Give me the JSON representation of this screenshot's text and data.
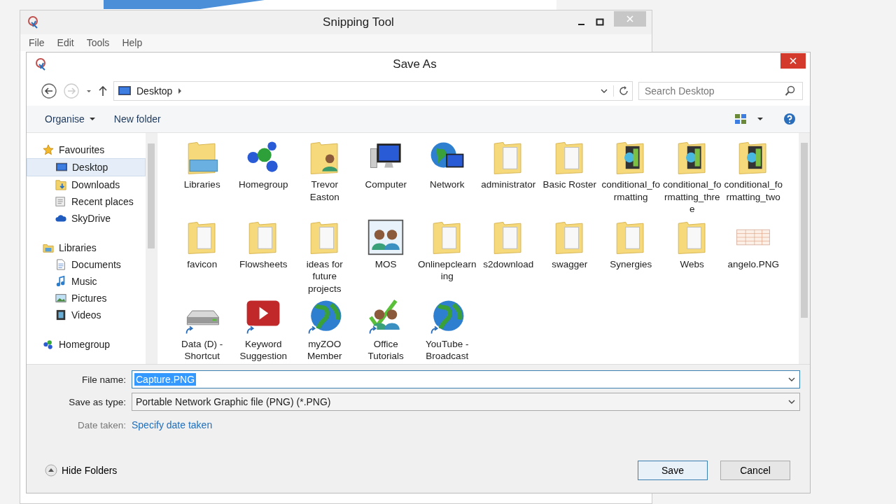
{
  "snipping_tool": {
    "title": "Snipping Tool",
    "menu": [
      "File",
      "Edit",
      "Tools",
      "Help"
    ]
  },
  "dialog": {
    "title": "Save As",
    "address": {
      "location": "Desktop"
    },
    "search": {
      "placeholder": "Search Desktop"
    },
    "toolbar": {
      "organise": "Organise",
      "new_folder": "New folder"
    },
    "sidebar": [
      {
        "label": "Favourites",
        "kind": "star",
        "selected": false,
        "children": [
          {
            "label": "Desktop",
            "kind": "desktop",
            "selected": true
          },
          {
            "label": "Downloads",
            "kind": "downloads",
            "selected": false
          },
          {
            "label": "Recent places",
            "kind": "recent",
            "selected": false
          },
          {
            "label": "SkyDrive",
            "kind": "cloud",
            "selected": false
          }
        ]
      },
      {
        "label": "Libraries",
        "kind": "library",
        "selected": false,
        "children": [
          {
            "label": "Documents",
            "kind": "documents",
            "selected": false
          },
          {
            "label": "Music",
            "kind": "music",
            "selected": false
          },
          {
            "label": "Pictures",
            "kind": "pictures",
            "selected": false
          },
          {
            "label": "Videos",
            "kind": "videos",
            "selected": false
          }
        ]
      },
      {
        "label": "Homegroup",
        "kind": "homegroup",
        "selected": false
      }
    ],
    "items": [
      {
        "label": "Libraries",
        "kind": "library",
        "shortcut": false
      },
      {
        "label": "Homegroup",
        "kind": "homegroup",
        "shortcut": false
      },
      {
        "label": "Trevor Easton",
        "kind": "user",
        "shortcut": false
      },
      {
        "label": "Computer",
        "kind": "computer",
        "shortcut": false
      },
      {
        "label": "Network",
        "kind": "network",
        "shortcut": false
      },
      {
        "label": "administrator",
        "kind": "folder",
        "shortcut": false
      },
      {
        "label": "Basic Roster",
        "kind": "folder",
        "shortcut": false
      },
      {
        "label": "conditional_formatting",
        "kind": "media_folder",
        "shortcut": false
      },
      {
        "label": "conditional_formatting_three",
        "kind": "media_folder",
        "shortcut": false
      },
      {
        "label": "conditional_formatting_two",
        "kind": "media_folder",
        "shortcut": false
      },
      {
        "label": "favicon",
        "kind": "folder",
        "shortcut": false
      },
      {
        "label": "Flowsheets",
        "kind": "folder",
        "shortcut": false
      },
      {
        "label": "ideas for future projects",
        "kind": "folder",
        "shortcut": false
      },
      {
        "label": "MOS",
        "kind": "people",
        "shortcut": false
      },
      {
        "label": "Onlinepclearning",
        "kind": "folder",
        "shortcut": false
      },
      {
        "label": "s2download",
        "kind": "folder",
        "shortcut": false
      },
      {
        "label": "swagger",
        "kind": "folder",
        "shortcut": false
      },
      {
        "label": "Synergies",
        "kind": "folder",
        "shortcut": false
      },
      {
        "label": "Webs",
        "kind": "folder",
        "shortcut": false
      },
      {
        "label": "angelo.PNG",
        "kind": "image",
        "shortcut": false
      },
      {
        "label": "Data (D) - Shortcut",
        "kind": "drive",
        "shortcut": true
      },
      {
        "label": "Keyword Suggestion",
        "kind": "video",
        "shortcut": true
      },
      {
        "label": "myZOO Member",
        "kind": "globe",
        "shortcut": true
      },
      {
        "label": "Office Tutorials",
        "kind": "people_check",
        "shortcut": true
      },
      {
        "label": "YouTube - Broadcast",
        "kind": "globe",
        "shortcut": true
      }
    ],
    "file_name": {
      "label": "File name:",
      "value": "Capture.PNG",
      "value_selected": true
    },
    "save_as_type": {
      "label": "Save as type:",
      "value": "Portable Network Graphic file (PNG) (*.PNG)"
    },
    "date_taken": {
      "label": "Date taken:",
      "link": "Specify date taken"
    },
    "hide_folders": "Hide Folders",
    "buttons": [
      {
        "label": "Save",
        "kind": "default"
      },
      {
        "label": "Cancel",
        "kind": "normal"
      }
    ]
  }
}
